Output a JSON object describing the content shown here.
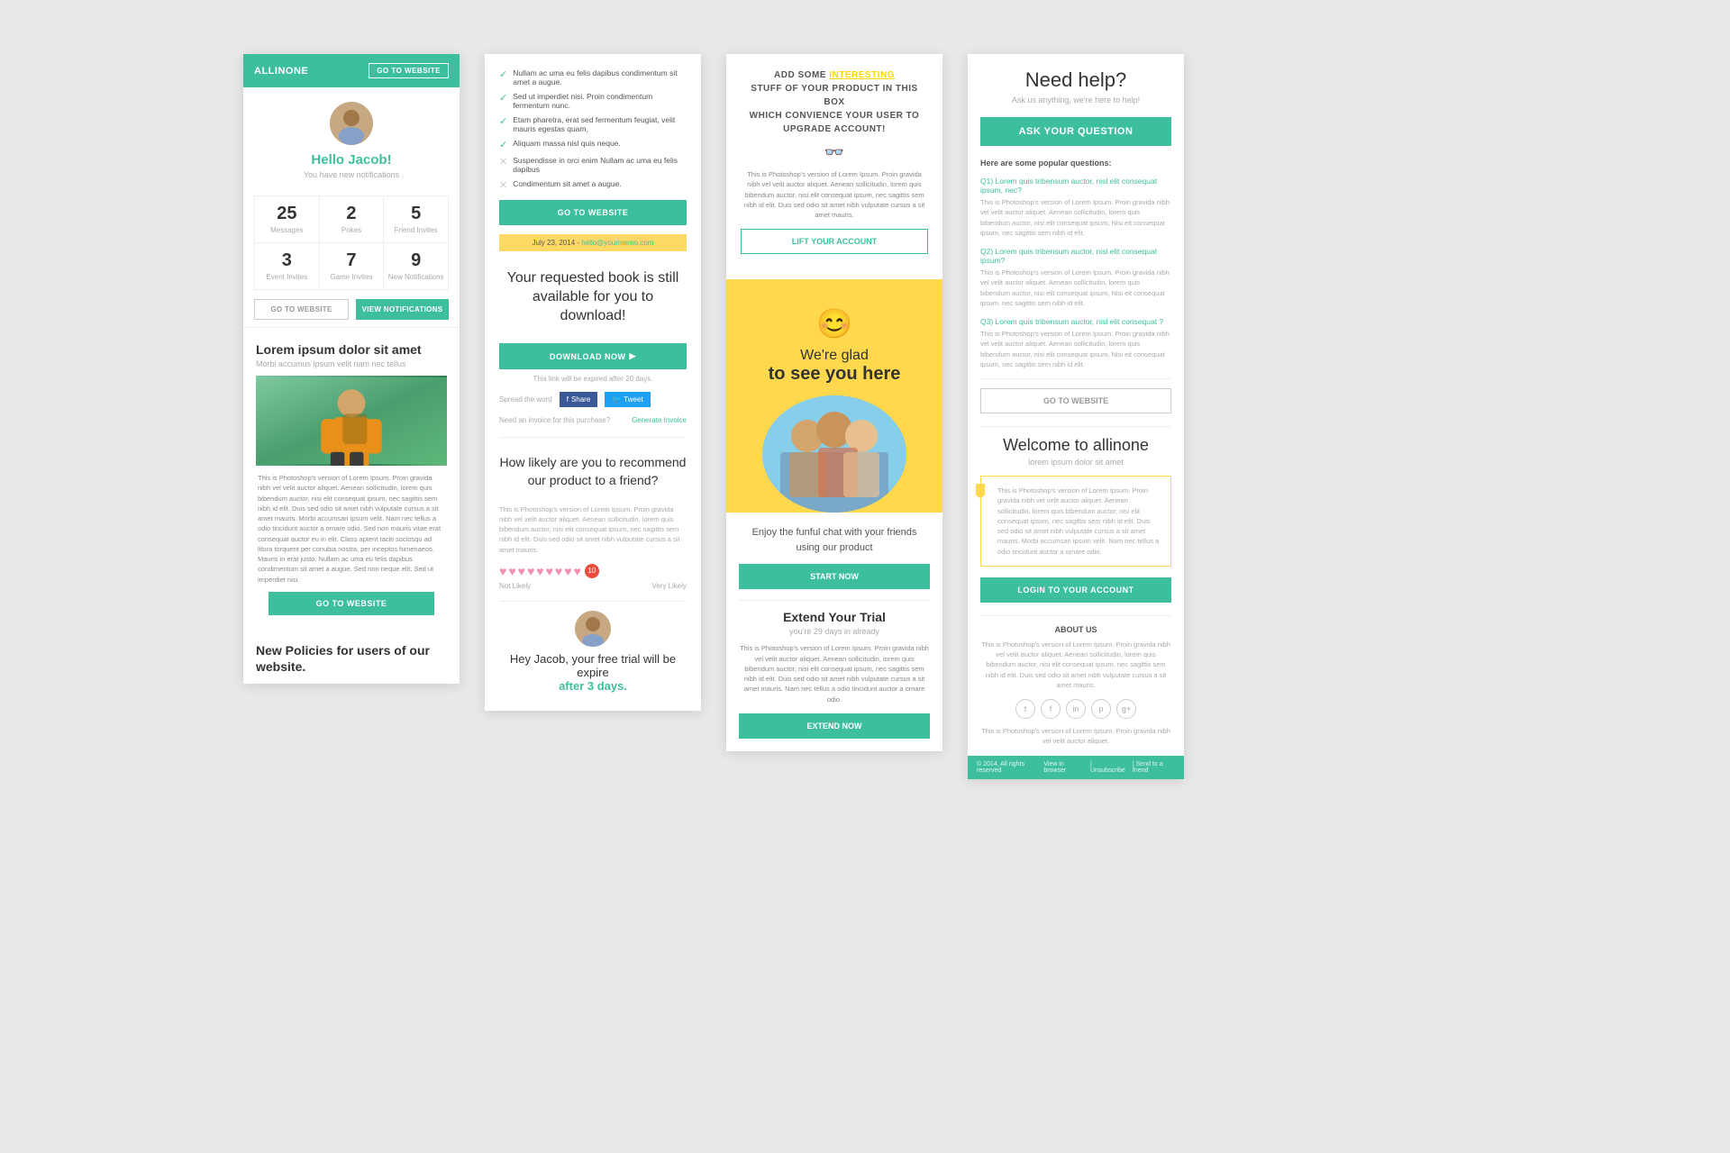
{
  "card1": {
    "header_title": "ALLINONE",
    "header_btn": "GO TO WEBSITE",
    "hello_text": "Hello Jacob!",
    "sub_text": "You have new notifications",
    "stats": [
      {
        "num": "25",
        "label": "Messages"
      },
      {
        "num": "2",
        "label": "Pokes"
      },
      {
        "num": "5",
        "label": "Friend Invites"
      },
      {
        "num": "3",
        "label": "Event Invites"
      },
      {
        "num": "7",
        "label": "Game Invites"
      },
      {
        "num": "9",
        "label": "New Notifications"
      }
    ],
    "btn_website": "GO TO WEBSITE",
    "btn_notifications": "VIEW NOTIFICATIONS",
    "lorem_title": "Lorem ipsum dolor sit amet",
    "lorem_sub": "Morbi accumus ipsum velit nam nec tellus",
    "body_text": "This is Photoshop's version of Lorem Ipsum. Proin gravida nibh vel velit auctor aliquet. Aenean sollicitudin, lorem quis bibendum auctor, nisi elit consequat ipsum, nec sagittis sem nibh id elit. Duis sed odio sit amet nibh vulputate cursus a sit amet mauris. Morbi accumsan ipsum velit. Nam nec tellus a odio tincidunt auctor a ornare odio. Sed non mauris vitae erat consequat auctor eu in elit. Class aptent taciti sociosqu ad litora torquent per conubia nostra, per inceptos himenaeos. Mauris in erat justo. Nullam ac uma eu felis dapibus condimentum sit amet a augue. Sed non neque elit. Sed ut imperdiet nisi.",
    "go_website_btn": "GO TO WEBSITE",
    "policies_title": "New Policies for users of our website."
  },
  "card2": {
    "checklist": [
      {
        "text": "Nullam ac uma eu felis dapibus condimentum sit amet a augue.",
        "checked": true
      },
      {
        "text": "Sed ut imperdiet nisi. Proin condimentum fermentum nunc.",
        "checked": true
      },
      {
        "text": "Etam pharetra, erat sed fermentum feugiat, velit mauris egestas quam,",
        "checked": true
      },
      {
        "text": "Aliquam massa nisl quis neque.",
        "checked": true
      },
      {
        "text": "Suspendisse in orci enim Nullam ac uma eu felis dapibus",
        "checked": false
      },
      {
        "text": "Condimentum sit amet a augue.",
        "checked": false
      }
    ],
    "go_btn": "GO TO WEBSITE",
    "date_bar": "July 23, 2014 - hello@yourmemo.com",
    "book_title": "Your requested book is still available for you to download!",
    "download_btn": "DOWNLOAD NOW",
    "expire_text": "This link will be expired after 20 days.",
    "spread_label": "Spread the word",
    "fb_btn": "Share",
    "tw_btn": "Tweet",
    "invoice_text": "Need an invoice for this purchase?",
    "invoice_link": "Generate Invoice",
    "recommend_title": "How likely are you to recommend our product to a friend?",
    "body_text": "This is Photoshop's version of Lorem Ipsum. Proin gravida nibh vel velit auctor aliquet. Aenean sollicitudin, lorem quis bibendum auctor, nisi elit consequat ipsum, nec sagittis sem nibh id elit. Duis sed odio sit amet nibh vulputate cursus a sit amet mauris.",
    "not_likely": "Not Likely",
    "very_likely": "Very Likely",
    "hearts_count": "10",
    "trial_text": "Hey Jacob, your free trial will be expire",
    "expire_days": "after 3 days."
  },
  "card3": {
    "add_text_1": "ADD SOME",
    "interesting": "INTERESTING",
    "add_text_2": "STUFF OF YOUR PRODUCT IN THIS BOX WHICH CONVIENCE YOUR USER TO UPGRADE ACCOUNT!",
    "body_text": "This is Photoshop's version of Lorem Ipsum. Proin gravida nibh vel velit auctor aliquet. Aenean sollicitudin, lorem quis bibendum auctor, nisi elit consequat ipsum, nec sagittis sem nibh id elit. Duis sed odio sit amet nibh vulputate cursus a sit amet mauris.",
    "lift_btn": "LIFT YOUR ACCOUNT",
    "glad_text": "We're glad",
    "glad_bold": "to see you here",
    "enjoy_text": "Enjoy the funful chat with your friends using our product",
    "start_btn": "START NOW",
    "trial_title": "Extend Your Trial",
    "trial_sub": "you're 29 days in already",
    "trial_body": "This is Photoshop's version of Lorem Ipsum. Proin gravida nibh vel velit auctor aliquet. Aenean sollicitudin, lorem quis bibendum auctor, nisi elit consequat ipsum, nec sagittis sem nibh id elit. Duis sed odio sit amet nibh vulputate cursus a sit amet mauris. Nam nec tellus a odio tincidunt auctor a ornare odio.",
    "extend_btn": "EXTEND NOW"
  },
  "card4": {
    "need_help": "Need help?",
    "help_sub": "Ask us anything, we're here to help!",
    "ask_btn": "ASK YOUR QUESTION",
    "popular_title": "Here are some popular questions:",
    "faqs": [
      {
        "q": "Q1) Lorem quis tribensum auctor, nisl elit consequat ipsum, nec?",
        "a": "This is Photoshop's version of Lorem Ipsum. Proin gravida nibh vel velit auctor aliquet. Aenean sollicitudin, lorem quis bibendum auctor, nisi elit consequat ipsum, nec sagittis sem nibh id elit."
      },
      {
        "q": "Q2) Lorem quis tribensum auctor, nisl elit consequat ipsum?",
        "a": "This is Photoshop's version of Lorem Ipsum. Proin gravida nibh vel velit auctor aliquet. Aenean sollicitudin, lorem quis bibendum auctor, nisi elit consequat ipsum, nec sagittis sem nibh id elit."
      },
      {
        "q": "Q3) Lorem quis tribensum auctor, nisl elit consequat ?",
        "a": "This is Photoshop's version of Lorem Ipsum. Proin gravida nibh vel velit auctor aliquet. Aenean sollicitudin, lorem quis bibendum auctor, nisi elit consequat ipsum, nec sagittis sem nibh id elit."
      }
    ],
    "go_btn": "GO TO WEBSITE",
    "welcome_title": "Welcome to allinone",
    "welcome_sub": "lorem ipsum dolor sit amet",
    "yellow_box_text": "This is Photoshop's version of Lorem Ipsum. Proin gravida nibh vel velit auctor aliquet. Aenean sollicitudin, lorem quis bibendum auctor, nisi elit consequat ipsum, nec sagittis sem nibh id elit. Duis sed odio sit amet nibh vulputate cursus a sit amet mauris. Morbi accumsan ipsum velit. Nam nec tellus a odio tincidunt auctor a ornare odio.",
    "login_btn": "LOGIN TO YOUR ACCOUNT",
    "about_title": "ABOUT US",
    "about_text": "This is Photoshop's version of Lorem Ipsum. Proin gravida nibh vel velit auctor aliquet. Aenean sollicitudin, lorem quis bibendum auctor, nisi elit consequat ipsum, nec sagittis sem nibh id elit. Duis sed odio sit amet nibh vulputate cursus a sit amet mauris.",
    "social_icons": [
      "t",
      "f",
      "in",
      "p",
      "g+"
    ],
    "footer_copy": "© 2014, All rights reserved",
    "footer_links": [
      "View in browser",
      "Unsubscribe",
      "Send to a friend"
    ]
  }
}
